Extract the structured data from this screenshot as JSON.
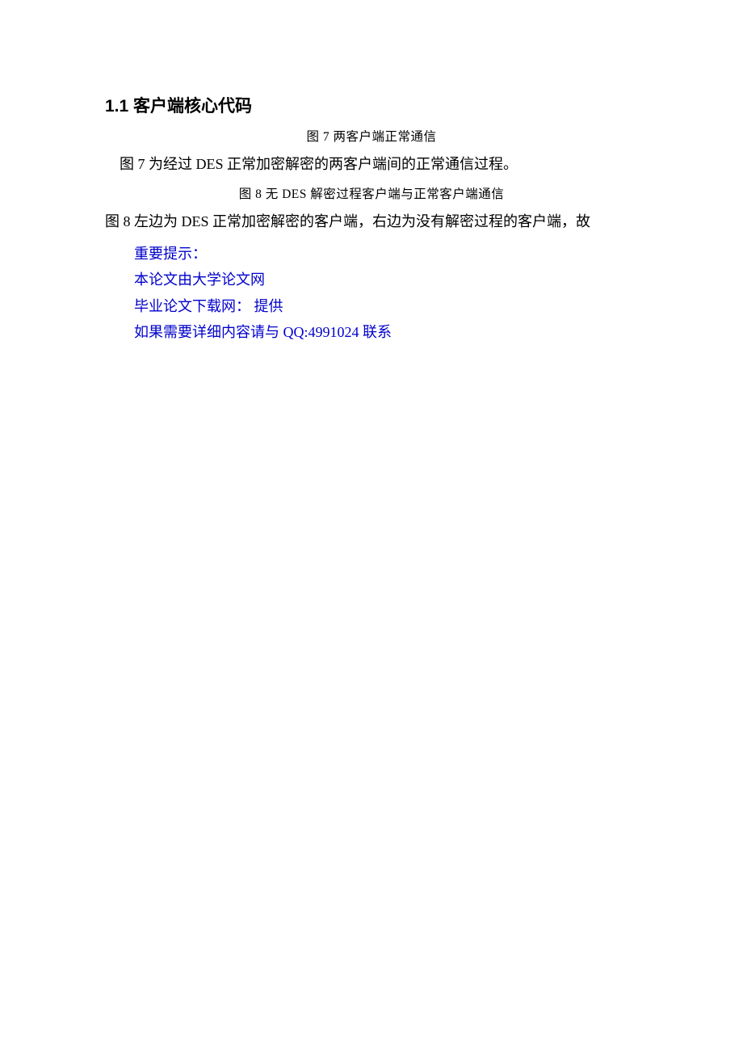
{
  "heading": "1.1 客户端核心代码",
  "caption1": "图 7 两客户端正常通信",
  "para1": "图 7 为经过 DES 正常加密解密的两客户端间的正常通信过程。",
  "caption2": "图 8 无 DES 解密过程客户端与正常客户端通信",
  "para2": "图 8 左边为 DES 正常加密解密的客户端，右边为没有解密过程的客户端，故",
  "note1": "重要提示：",
  "note2": "本论文由大学论文网",
  "note3": "毕业论文下载网：  提供",
  "note4": "如果需要详细内容请与 QQ:4991024 联系"
}
